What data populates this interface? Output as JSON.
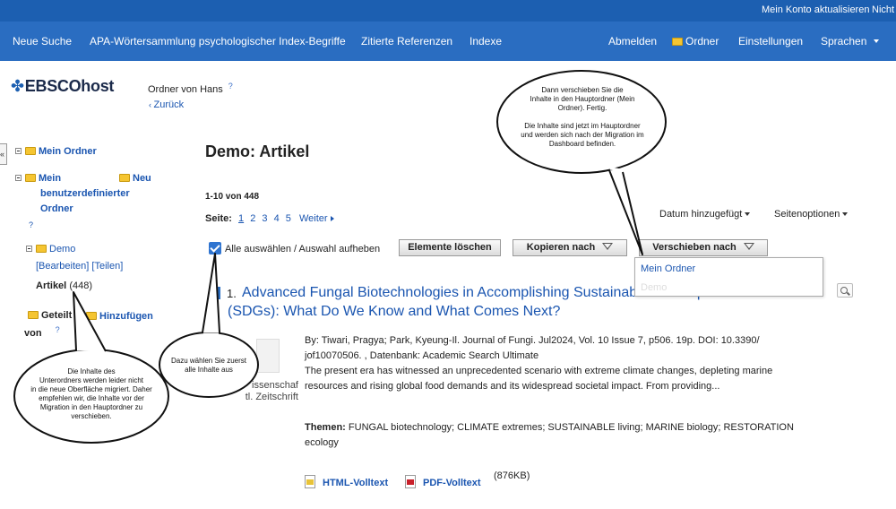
{
  "topbar": {
    "update_account": "Mein Konto aktualisieren",
    "not": "Nicht"
  },
  "nav": {
    "new_search": "Neue Suche",
    "thesaurus": "APA-Wörtersammlung psychologischer Index-Begriffe",
    "cited_refs": "Zitierte Referenzen",
    "indexes": "Indexe",
    "logout": "Abmelden",
    "folder": "Ordner",
    "settings": "Einstellungen",
    "languages": "Sprachen"
  },
  "brand": {
    "logo": "EBSCOhost"
  },
  "header": {
    "folder_owner": "Ordner von Hans",
    "help": "?",
    "back": "Zurück"
  },
  "sidebar": {
    "collapse": "«",
    "my_folder": "Mein Ordner",
    "custom_folders": [
      "Mein",
      "benutzerdefinierter",
      "Ordner"
    ],
    "new": "Neu",
    "help": "?",
    "demo": "Demo",
    "edit": "[Bearbeiten]",
    "share": "[Teilen]",
    "articles": "Artikel",
    "articles_count": "(448)",
    "shared": "Geteilt",
    "shared_by": "von",
    "add": "Hinzufügen"
  },
  "main": {
    "title": "Demo: Artikel",
    "count": "1-10 von 448",
    "page_label": "Seite:",
    "pages": [
      "1",
      "2",
      "3",
      "4",
      "5"
    ],
    "next": "Weiter",
    "sort": "Datum hinzugefügt",
    "page_options": "Seitenoptionen",
    "select_all": "Alle auswählen / Auswahl aufheben",
    "delete": "Elemente löschen",
    "copy_to": "Kopieren nach",
    "move_to": "Verschieben nach",
    "dropdown": [
      "Mein Ordner",
      "Demo"
    ]
  },
  "result": {
    "number": "1.",
    "title_line1": "Advanced Fungal Biotechnologies in Accomplishing Sustainable Development Goals",
    "title_line2": "(SDGs): What Do We Know and What Comes Next?",
    "pub_type_1": "issenschaf",
    "pub_type_2": "tl. Zeitschrift",
    "citation_1": "By: Tiwari, Pragya; Park, Kyeung-Il. Journal of Fungi. Jul2024, Vol. 10 Issue 7, p506. 19p. DOI: 10.3390/",
    "citation_2": "jof10070506. , Datenbank: Academic Search Ultimate",
    "abstract_1": "The present era has witnessed an unprecedented scenario with extreme climate changes, depleting marine",
    "abstract_2": "resources and rising global food demands and its widespread societal impact. From providing...",
    "themes_label": "Themen:",
    "themes_1": "FUNGAL biotechnology; CLIMATE extremes; SUSTAINABLE living; MARINE biology; RESTORATION",
    "themes_2": "ecology",
    "html_fulltext": "HTML-Volltext",
    "pdf_fulltext": "PDF-Volltext",
    "pdf_size": "(876KB)"
  },
  "callouts": {
    "move_1": "Dann verschieben Sie die",
    "move_2": "Inhalte in den Hauptordner (Mein",
    "move_3": "Ordner). Fertig.",
    "move_4": "Die Inhalte sind jetzt im Hauptordner",
    "move_5": "und werden sich nach der Migration im",
    "move_6": "Dashboard befinden.",
    "select_1": "Dazu wählen Sie zuerst",
    "select_2": "alle Inhalte aus",
    "sub_1": "Die Inhalte des",
    "sub_2": "Unterordners werden leider nicht",
    "sub_3": "in die neue Oberfläche migriert. Daher",
    "sub_4": "empfehlen wir, die Inhalte vor der",
    "sub_5": "Migration in den Hauptordner zu",
    "sub_6": "verschieben."
  },
  "colors": {
    "nav_bg": "#2a6dc1",
    "topbar_bg": "#1c5fb1",
    "link": "#1a55b0"
  }
}
